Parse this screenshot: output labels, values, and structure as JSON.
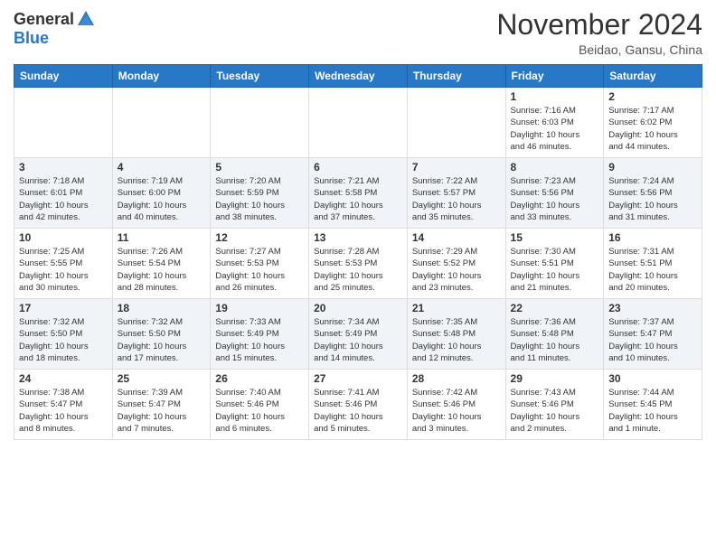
{
  "header": {
    "logo_general": "General",
    "logo_blue": "Blue",
    "month_title": "November 2024",
    "location": "Beidao, Gansu, China"
  },
  "weekdays": [
    "Sunday",
    "Monday",
    "Tuesday",
    "Wednesday",
    "Thursday",
    "Friday",
    "Saturday"
  ],
  "weeks": [
    [
      {
        "day": "",
        "info": ""
      },
      {
        "day": "",
        "info": ""
      },
      {
        "day": "",
        "info": ""
      },
      {
        "day": "",
        "info": ""
      },
      {
        "day": "",
        "info": ""
      },
      {
        "day": "1",
        "info": "Sunrise: 7:16 AM\nSunset: 6:03 PM\nDaylight: 10 hours\nand 46 minutes."
      },
      {
        "day": "2",
        "info": "Sunrise: 7:17 AM\nSunset: 6:02 PM\nDaylight: 10 hours\nand 44 minutes."
      }
    ],
    [
      {
        "day": "3",
        "info": "Sunrise: 7:18 AM\nSunset: 6:01 PM\nDaylight: 10 hours\nand 42 minutes."
      },
      {
        "day": "4",
        "info": "Sunrise: 7:19 AM\nSunset: 6:00 PM\nDaylight: 10 hours\nand 40 minutes."
      },
      {
        "day": "5",
        "info": "Sunrise: 7:20 AM\nSunset: 5:59 PM\nDaylight: 10 hours\nand 38 minutes."
      },
      {
        "day": "6",
        "info": "Sunrise: 7:21 AM\nSunset: 5:58 PM\nDaylight: 10 hours\nand 37 minutes."
      },
      {
        "day": "7",
        "info": "Sunrise: 7:22 AM\nSunset: 5:57 PM\nDaylight: 10 hours\nand 35 minutes."
      },
      {
        "day": "8",
        "info": "Sunrise: 7:23 AM\nSunset: 5:56 PM\nDaylight: 10 hours\nand 33 minutes."
      },
      {
        "day": "9",
        "info": "Sunrise: 7:24 AM\nSunset: 5:56 PM\nDaylight: 10 hours\nand 31 minutes."
      }
    ],
    [
      {
        "day": "10",
        "info": "Sunrise: 7:25 AM\nSunset: 5:55 PM\nDaylight: 10 hours\nand 30 minutes."
      },
      {
        "day": "11",
        "info": "Sunrise: 7:26 AM\nSunset: 5:54 PM\nDaylight: 10 hours\nand 28 minutes."
      },
      {
        "day": "12",
        "info": "Sunrise: 7:27 AM\nSunset: 5:53 PM\nDaylight: 10 hours\nand 26 minutes."
      },
      {
        "day": "13",
        "info": "Sunrise: 7:28 AM\nSunset: 5:53 PM\nDaylight: 10 hours\nand 25 minutes."
      },
      {
        "day": "14",
        "info": "Sunrise: 7:29 AM\nSunset: 5:52 PM\nDaylight: 10 hours\nand 23 minutes."
      },
      {
        "day": "15",
        "info": "Sunrise: 7:30 AM\nSunset: 5:51 PM\nDaylight: 10 hours\nand 21 minutes."
      },
      {
        "day": "16",
        "info": "Sunrise: 7:31 AM\nSunset: 5:51 PM\nDaylight: 10 hours\nand 20 minutes."
      }
    ],
    [
      {
        "day": "17",
        "info": "Sunrise: 7:32 AM\nSunset: 5:50 PM\nDaylight: 10 hours\nand 18 minutes."
      },
      {
        "day": "18",
        "info": "Sunrise: 7:32 AM\nSunset: 5:50 PM\nDaylight: 10 hours\nand 17 minutes."
      },
      {
        "day": "19",
        "info": "Sunrise: 7:33 AM\nSunset: 5:49 PM\nDaylight: 10 hours\nand 15 minutes."
      },
      {
        "day": "20",
        "info": "Sunrise: 7:34 AM\nSunset: 5:49 PM\nDaylight: 10 hours\nand 14 minutes."
      },
      {
        "day": "21",
        "info": "Sunrise: 7:35 AM\nSunset: 5:48 PM\nDaylight: 10 hours\nand 12 minutes."
      },
      {
        "day": "22",
        "info": "Sunrise: 7:36 AM\nSunset: 5:48 PM\nDaylight: 10 hours\nand 11 minutes."
      },
      {
        "day": "23",
        "info": "Sunrise: 7:37 AM\nSunset: 5:47 PM\nDaylight: 10 hours\nand 10 minutes."
      }
    ],
    [
      {
        "day": "24",
        "info": "Sunrise: 7:38 AM\nSunset: 5:47 PM\nDaylight: 10 hours\nand 8 minutes."
      },
      {
        "day": "25",
        "info": "Sunrise: 7:39 AM\nSunset: 5:47 PM\nDaylight: 10 hours\nand 7 minutes."
      },
      {
        "day": "26",
        "info": "Sunrise: 7:40 AM\nSunset: 5:46 PM\nDaylight: 10 hours\nand 6 minutes."
      },
      {
        "day": "27",
        "info": "Sunrise: 7:41 AM\nSunset: 5:46 PM\nDaylight: 10 hours\nand 5 minutes."
      },
      {
        "day": "28",
        "info": "Sunrise: 7:42 AM\nSunset: 5:46 PM\nDaylight: 10 hours\nand 3 minutes."
      },
      {
        "day": "29",
        "info": "Sunrise: 7:43 AM\nSunset: 5:46 PM\nDaylight: 10 hours\nand 2 minutes."
      },
      {
        "day": "30",
        "info": "Sunrise: 7:44 AM\nSunset: 5:45 PM\nDaylight: 10 hours\nand 1 minute."
      }
    ]
  ]
}
